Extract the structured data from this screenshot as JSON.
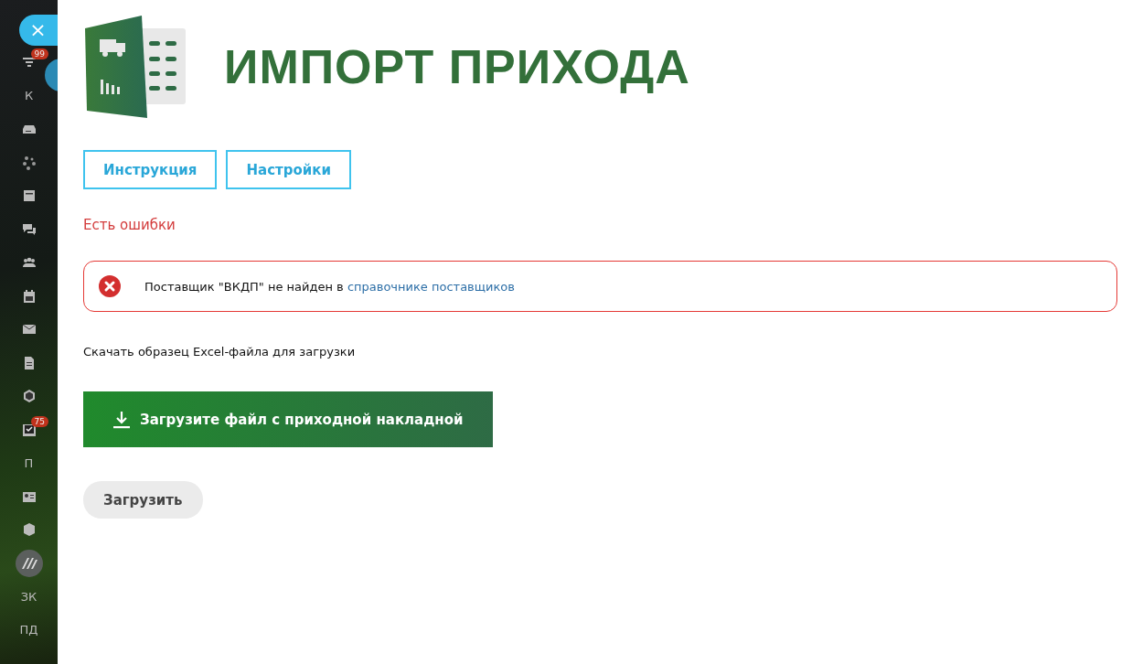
{
  "sidebar": {
    "items": [
      {
        "kind": "close",
        "label": "×"
      },
      {
        "kind": "icon",
        "badge": "99"
      },
      {
        "kind": "letter",
        "label": "К"
      },
      {
        "kind": "icon"
      },
      {
        "kind": "icon"
      },
      {
        "kind": "icon"
      },
      {
        "kind": "icon"
      },
      {
        "kind": "icon"
      },
      {
        "kind": "icon"
      },
      {
        "kind": "icon"
      },
      {
        "kind": "icon"
      },
      {
        "kind": "icon"
      },
      {
        "kind": "icon",
        "badge": "75"
      },
      {
        "kind": "letter",
        "label": "П"
      },
      {
        "kind": "icon"
      },
      {
        "kind": "icon"
      },
      {
        "kind": "logo"
      },
      {
        "kind": "letter",
        "label": "ЗК"
      },
      {
        "kind": "letter",
        "label": "ПД"
      }
    ]
  },
  "header": {
    "title": "ИМПОРТ ПРИХОДА"
  },
  "tabs": [
    {
      "label": "Инструкция"
    },
    {
      "label": "Настройки"
    }
  ],
  "status": {
    "text": "Есть ошибки"
  },
  "errors": [
    {
      "text": "Поставщик \"ВКДП\" не найден в ",
      "link": "справочнике поставщиков"
    }
  ],
  "sample_link": "Скачать образец Excel-файла для загрузки",
  "file_button": "Загрузите файл с приходной накладной",
  "submit_button": "Загрузить"
}
